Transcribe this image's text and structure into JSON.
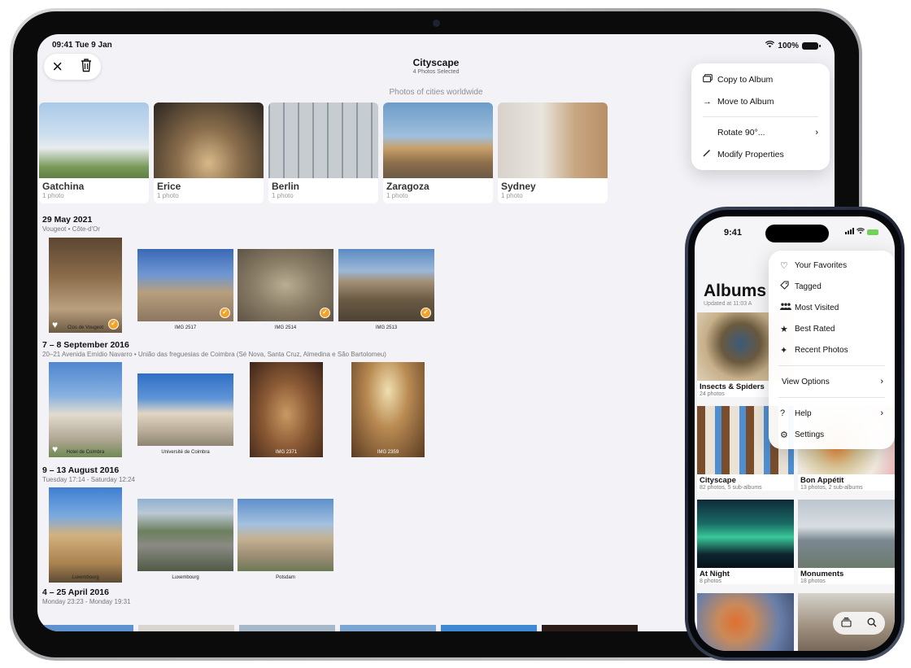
{
  "ipad": {
    "status": {
      "time": "09:41  Tue 9 Jan",
      "battery": "100%"
    },
    "toolbar": {
      "close_icon": "×",
      "trash_icon": "🗑"
    },
    "header": {
      "title": "Cityscape",
      "subtitle": "4 Photos Selected"
    },
    "section_subtitle": "Photos of cities worldwide",
    "albums": [
      {
        "name": "Gatchina",
        "count": "1 photo"
      },
      {
        "name": "Erice",
        "count": "1 photo"
      },
      {
        "name": "Berlin",
        "count": "1 photo"
      },
      {
        "name": "Zaragoza",
        "count": "1 photo"
      },
      {
        "name": "Sydney",
        "count": "1 photo"
      }
    ],
    "groups": [
      {
        "date": "29 May 2021",
        "place": "Vougeot • Côte-d'Or",
        "photos": [
          {
            "caption": "Clos de Vougeot"
          },
          {
            "caption": "IMG 2517"
          },
          {
            "caption": "IMG 2514"
          },
          {
            "caption": "IMG 2513"
          }
        ]
      },
      {
        "date": "7 – 8 September 2016",
        "place": "20–21 Avenida Emídio Navarro • União das freguesias de Coimbra (Sé Nova, Santa Cruz, Almedina e São Bartolomeu)",
        "photos": [
          {
            "caption": "Hotel de Coimbra"
          },
          {
            "caption": "Université de Coimbra"
          },
          {
            "caption": "IMG 2371"
          },
          {
            "caption": "IMG 2359"
          }
        ]
      },
      {
        "date": "9 – 13 August 2016",
        "place": "Tuesday 17:14 - Saturday 12:24",
        "photos": [
          {
            "caption": "Luxembourg"
          },
          {
            "caption": "Luxembourg"
          },
          {
            "caption": "Potsdam"
          }
        ]
      },
      {
        "date": "4 – 25 April 2016",
        "place": "Monday 23:23 - Monday 19:31",
        "photos": []
      }
    ],
    "menu": {
      "copy": "Copy to Album",
      "move": "Move to Album",
      "rotate": "Rotate 90°...",
      "modify": "Modify Properties"
    }
  },
  "iphone": {
    "status": {
      "time": "9:41"
    },
    "title": "Albums",
    "updated": "Updated at 11:03 A",
    "albums": [
      {
        "name": "Insects & Spiders",
        "count": "24 photos"
      },
      {
        "name": "Cityscape",
        "count": "82 photos, 5 sub-albums"
      },
      {
        "name": "Bon Appétit",
        "count": "13 photos, 2 sub-albums"
      },
      {
        "name": "At Night",
        "count": "8 photos"
      },
      {
        "name": "Monuments",
        "count": "18 photos"
      }
    ],
    "menu": {
      "favorites": "Your Favorites",
      "tagged": "Tagged",
      "most_visited": "Most Visited",
      "best_rated": "Best Rated",
      "recent": "Recent Photos",
      "view_options": "View Options",
      "help": "Help",
      "settings": "Settings"
    }
  },
  "colors": {
    "accent": "#f3a32a",
    "screen_bg": "#f2f2f7"
  }
}
